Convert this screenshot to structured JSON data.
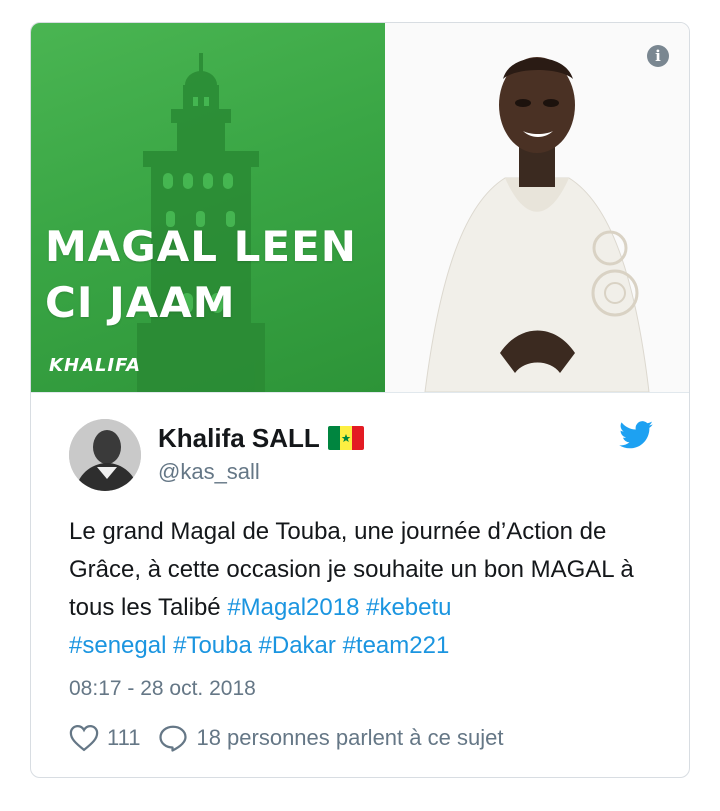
{
  "media": {
    "headline_line1": "MAGAL LEEN",
    "headline_line2": "CI JAAM",
    "brand": "KHALIFA",
    "info_icon": "i"
  },
  "author": {
    "name": "Khalifa SALL",
    "handle": "@kas_sall",
    "flag": "senegal-flag-icon"
  },
  "tweet": {
    "text": "Le grand Magal de Touba, une journée d’Action de Grâce, à cette occasion je souhaite un bon MAGAL à tous les Talibé ",
    "hashtags": [
      "#Magal2018",
      "#kebetu",
      "#senegal",
      "#Touba",
      "#Dakar",
      "#team221"
    ],
    "timestamp": "08:17 - 28 oct. 2018"
  },
  "actions": {
    "like_count": "111",
    "conversation": "18 personnes parlent à ce sujet"
  },
  "colors": {
    "link": "#1b95e0",
    "muted": "#657786",
    "twitter_blue": "#1da1f2",
    "green": "#3aa645"
  }
}
